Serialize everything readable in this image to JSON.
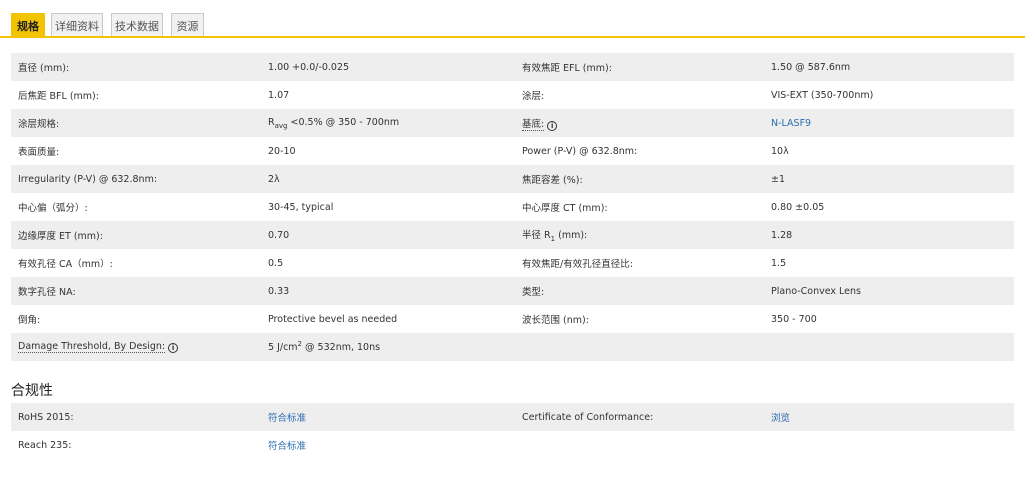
{
  "tabs": [
    {
      "label": "规格"
    },
    {
      "label": "详细资料"
    },
    {
      "label": "技术数据"
    },
    {
      "label": "资源"
    }
  ],
  "specs": [
    {
      "k1": "直径 (mm):",
      "v1": "1.00 +0.0/-0.025",
      "k2": "有效焦距 EFL (mm):",
      "v2": "1.50 @ 587.6nm"
    },
    {
      "k1": "后焦距 BFL (mm):",
      "v1": "1.07",
      "k2": "涂层:",
      "v2": "VIS-EXT (350-700nm)"
    },
    {
      "k1": "涂层规格:",
      "v1_r": "R",
      "v1_sub": "avg",
      "v1_rest": " <0.5% @ 350 - 700nm",
      "k2": "基底:",
      "v2": "N-LASF9"
    },
    {
      "k1": "表面质量:",
      "v1": "20-10",
      "k2": "Power (P-V) @ 632.8nm:",
      "v2": "10λ"
    },
    {
      "k1": "Irregularity (P-V) @ 632.8nm:",
      "v1": "2λ",
      "k2": "焦距容差 (%):",
      "v2": "±1"
    },
    {
      "k1": "中心偏（弧分）:",
      "v1": "30-45, typical",
      "k2": "中心厚度 CT (mm):",
      "v2": "0.80 ±0.05"
    },
    {
      "k1": "边缘厚度 ET (mm):",
      "v1": "0.70",
      "k2_a": "半径 R",
      "k2_sub": "1",
      "k2_b": " (mm):",
      "v2": "1.28"
    },
    {
      "k1": "有效孔径 CA（mm）:",
      "v1": "0.5",
      "k2": "有效焦距/有效孔径直径比:",
      "v2": "1.5"
    },
    {
      "k1": "数字孔径 NA:",
      "v1": "0.33",
      "k2": "类型:",
      "v2": "Plano-Convex Lens"
    },
    {
      "k1": "倒角:",
      "v1": "Protective bevel as needed",
      "k2": "波长范围 (nm):",
      "v2": "350 - 700"
    },
    {
      "k1": "Damage Threshold, By Design:",
      "v1_a": "5 J/cm",
      "v1_sup": "2",
      "v1_b": " @ 532nm, 10ns"
    }
  ],
  "info_glyph": "i",
  "compliance": {
    "title": "合规性",
    "rows": [
      {
        "k1": "RoHS 2015:",
        "v1": "符合标准",
        "k2": "Certificate of Conformance:",
        "v2": "浏览"
      },
      {
        "k1": "Reach 235:",
        "v1": "符合标准"
      }
    ]
  },
  "colors": {
    "accent": "#f2c300",
    "link": "#2a6cb0",
    "row_shade": "#eeeeee"
  }
}
